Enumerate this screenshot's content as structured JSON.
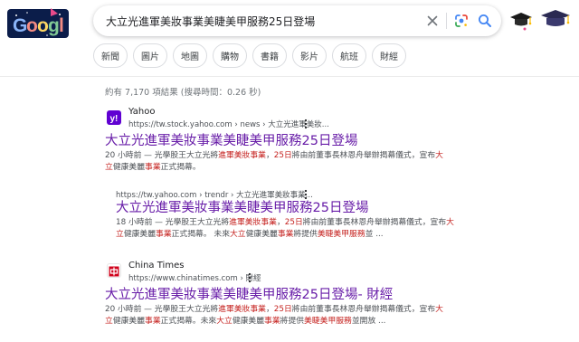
{
  "query": "大立光進軍美妝事業美睫美甲服務25日登場",
  "icons": {
    "logo": "google-doodle-logo",
    "clear": "close-icon",
    "lens": "google-lens-icon",
    "search": "search-icon",
    "doodle": "graduation-caps-doodle",
    "more": "more-vert-icon"
  },
  "colors": {
    "visited_title": "#681da8",
    "highlight": "#c5221f",
    "yahoo_purple": "#6001d2",
    "chinatimes_red": "#d0021b"
  },
  "tabs": [
    {
      "label": "新聞"
    },
    {
      "label": "圖片"
    },
    {
      "label": "地圖"
    },
    {
      "label": "購物"
    },
    {
      "label": "書籍"
    },
    {
      "label": "影片"
    },
    {
      "label": "航班"
    },
    {
      "label": "財經"
    }
  ],
  "stats": "約有 7,170 項結果 (搜尋時間：0.26 秒)",
  "results": [
    {
      "site": "Yahoo",
      "url": "https://tw.stock.yahoo.com › news › 大立光進軍美妝...",
      "title": "大立光進軍美妝事業美睫美甲服務25日登場",
      "line1": {
        "a": "20 小時前 — 光學股王大立光將",
        "b": "進軍美妝事業",
        "c": "，",
        "d": "25日",
        "e": "將由前董事長林恩舟舉辦揭幕儀式，宣布",
        "f": "大"
      },
      "line2": {
        "a": "立",
        "b": "健康美麗",
        "c": "事業",
        "d": "正式揭幕。"
      }
    },
    {
      "url": "https://tw.yahoo.com › trendr › 大立光進軍美妝事業...",
      "title": "大立光進軍美妝事業美睫美甲服務25日登場",
      "line1": {
        "a": "18 小時前 — 光學股王大立光將",
        "b": "進軍美妝事業",
        "c": "，",
        "d": "25日",
        "e": "將由前董事長林恩舟舉辦揭幕儀式，宣布",
        "f": "大"
      },
      "line2": {
        "a": "立",
        "b": "健康美麗",
        "c": "事業",
        "d": "正式揭幕。 未來",
        "e": "大立",
        "f": "健康美麗",
        "g": "事業",
        "h": "將提供",
        "i": "美睫美甲服務",
        "j": "並 ..."
      }
    },
    {
      "site": "China Times",
      "url": "https://www.chinatimes.com › 財經",
      "title": "大立光進軍美妝事業美睫美甲服務25日登場- 財經",
      "line1": {
        "a": "20 小時前 — 光學股王大立光將",
        "b": "進軍美妝事業",
        "c": "，",
        "d": "25日",
        "e": "將由前董事長林恩舟舉辦揭幕儀式，宣布",
        "f": "大"
      },
      "line2": {
        "a": "立",
        "b": "健康美麗",
        "c": "事業",
        "d": "正式揭幕。未來",
        "e": "大立",
        "f": "健康美麗",
        "g": "事業",
        "h": "將提供",
        "i": "美睫美甲服務",
        "j": "並開放 ..."
      }
    }
  ]
}
